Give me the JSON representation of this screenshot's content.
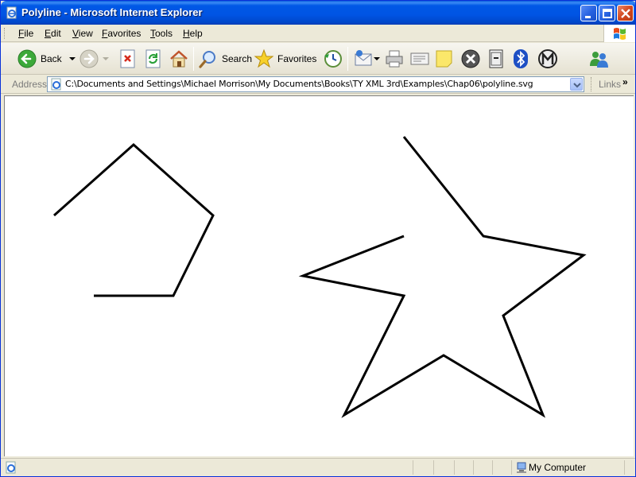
{
  "window": {
    "title": "Polyline - Microsoft Internet Explorer"
  },
  "menu": {
    "items": [
      {
        "label": "File"
      },
      {
        "label": "Edit"
      },
      {
        "label": "View"
      },
      {
        "label": "Favorites"
      },
      {
        "label": "Tools"
      },
      {
        "label": "Help"
      }
    ]
  },
  "toolbar": {
    "back_label": "Back",
    "search_label": "Search",
    "favorites_label": "Favorites"
  },
  "address": {
    "label": "Address",
    "value": "C:\\Documents and Settings\\Michael Morrison\\My Documents\\Books\\TY XML 3rd\\Examples\\Chap06\\polyline.svg",
    "links_label": "Links"
  },
  "status": {
    "zone": "My Computer"
  },
  "colors": {
    "title_bar": "#0054e3",
    "stroke": "#000000",
    "chrome": "#ece9d8"
  }
}
